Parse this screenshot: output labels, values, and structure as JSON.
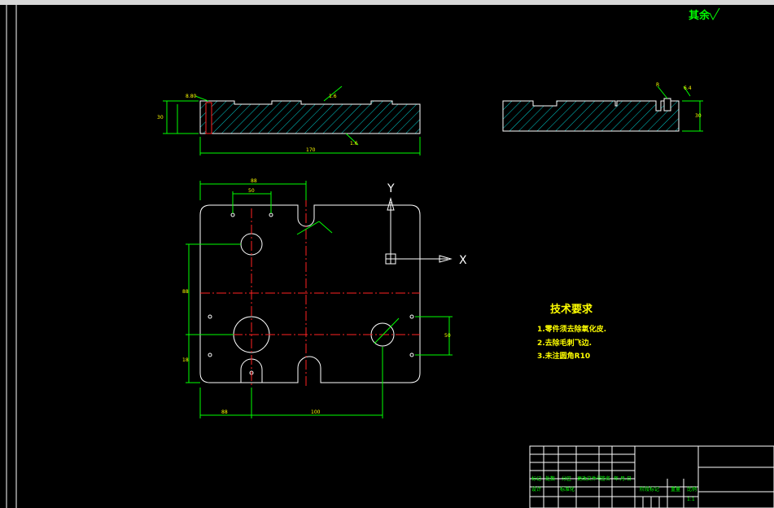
{
  "window": {
    "title_hint": ""
  },
  "drawing": {
    "top_view": {
      "dims": {
        "length": "170",
        "height": "30",
        "groove": "8.80",
        "roughness_top": "1.6",
        "roughness_bottom": "1.6"
      }
    },
    "side_view": {
      "dims": {
        "height": "30",
        "roughness": "6.4",
        "slot": "R"
      }
    },
    "plan_view": {
      "dims": {
        "width_top": "88",
        "hole_spacing_top": "50",
        "bottom_left": "88",
        "bottom_right": "100",
        "vert_left_upper": "88",
        "vert_left_lower": "18",
        "right_vertical": "50"
      },
      "axis_x": "X",
      "axis_y": "Y"
    },
    "notes": {
      "title": "技术要求",
      "items": [
        "1.零件须去除氧化皮.",
        "2.去除毛刺飞边.",
        "3.未注圆角R10"
      ]
    },
    "rest_label": "其余",
    "title_block": {
      "labels": [
        "标记",
        "处数",
        "分区",
        "更改文件号",
        "签名",
        "年.月.日",
        "设计",
        "标准化",
        "阶段标记",
        "重量",
        "比例"
      ],
      "scale": "1:1"
    }
  },
  "colors": {
    "outline": "#ffffff",
    "dimension": "#00ff00",
    "centerline": "#ff0000",
    "hatch": "#00ffff",
    "text": "#ffff00"
  }
}
